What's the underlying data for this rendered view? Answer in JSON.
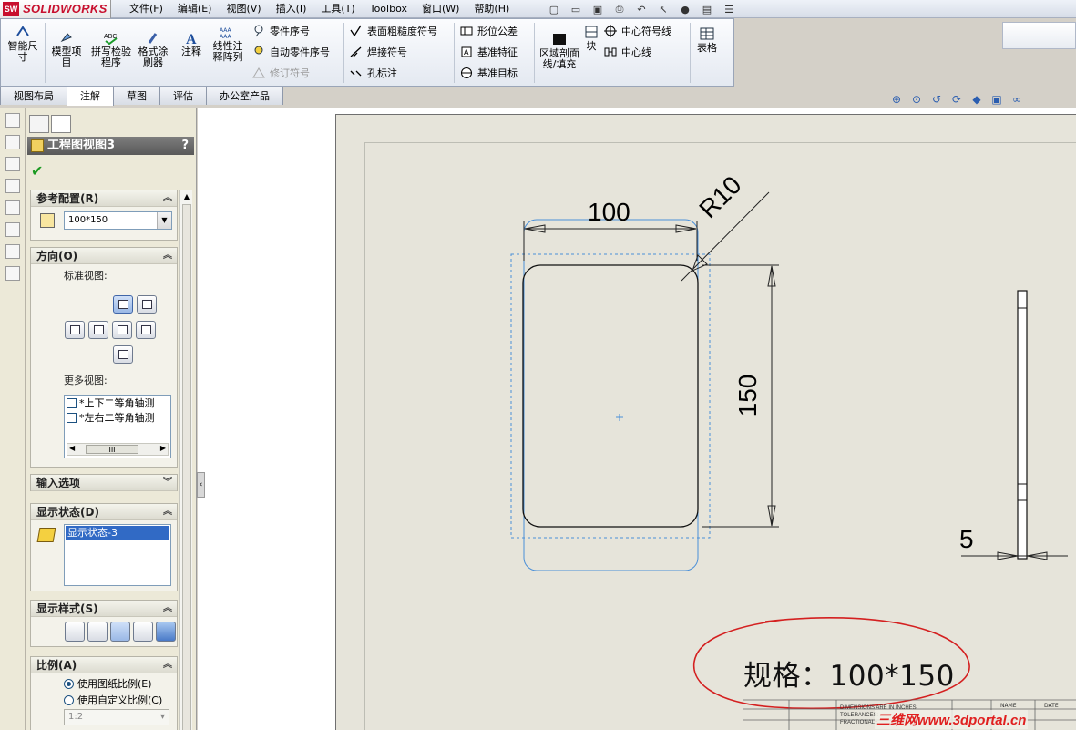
{
  "app": {
    "logo_text": "SOLIDWORKS",
    "logo_badge": "SW",
    "menu": [
      "文件(F)",
      "编辑(E)",
      "视图(V)",
      "插入(I)",
      "工具(T)",
      "Toolbox",
      "窗口(W)",
      "帮助(H)"
    ]
  },
  "ribbon": {
    "smart_dim": "智能尺寸",
    "model_items": "模型项目",
    "spell_check": "拼写检验程序",
    "format_painter": "格式涂刷器",
    "note": "注释",
    "linear_note": "线性注释阵列",
    "balloon": "零件序号",
    "auto_balloon": "自动零件序号",
    "revision": "修订符号",
    "surface_finish": "表面粗糙度符号",
    "weld": "焊接符号",
    "hole_callout": "孔标注",
    "gtol": "形位公差",
    "datum_feature": "基准特征",
    "datum_target": "基准目标",
    "area_hatch": "区域剖面线/填充",
    "block": "块",
    "center_mark": "中心符号线",
    "centerline": "中心线",
    "table": "表格"
  },
  "tabs": [
    "视图布局",
    "注解",
    "草图",
    "评估",
    "办公室产品"
  ],
  "active_tab": 1,
  "property_manager": {
    "title": "工程图视图3",
    "help": "?",
    "ref_config": {
      "header": "参考配置(R)",
      "value": "100*150"
    },
    "orientation": {
      "header": "方向(O)",
      "standard_views_label": "标准视图:",
      "more_views_label": "更多视图:",
      "more_views": [
        "*上下二等角轴测",
        "*左右二等角轴测"
      ],
      "scroll_grip": "III"
    },
    "import_options": {
      "header": "输入选项"
    },
    "display_state": {
      "header": "显示状态(D)",
      "selected": "显示状态-3"
    },
    "display_style": {
      "header": "显示样式(S)"
    },
    "scale": {
      "header": "比例(A)",
      "options": [
        "使用图纸比例(E)",
        "使用自定义比例(C)"
      ],
      "selected_index": 0,
      "custom_value": "1:2"
    }
  },
  "drawing": {
    "dim_width": "100",
    "dim_height": "150",
    "dim_radius": "R10",
    "dim_thickness": "5",
    "spec_note": "规格：100*150",
    "title_block_text": [
      "DIMENSIONS ARE IN INCHES",
      "TOLERANCES:",
      "FRACTIONAL±"
    ],
    "title_block_headers": [
      "NAME",
      "DATE"
    ],
    "watermark": "三维网www.3dportal.cn"
  },
  "colors": {
    "annotation_red": "#d42020",
    "preview_blue": "#4a8fd8",
    "sheet_bg": "#e6e4da",
    "watermark_red": "#e02020"
  }
}
